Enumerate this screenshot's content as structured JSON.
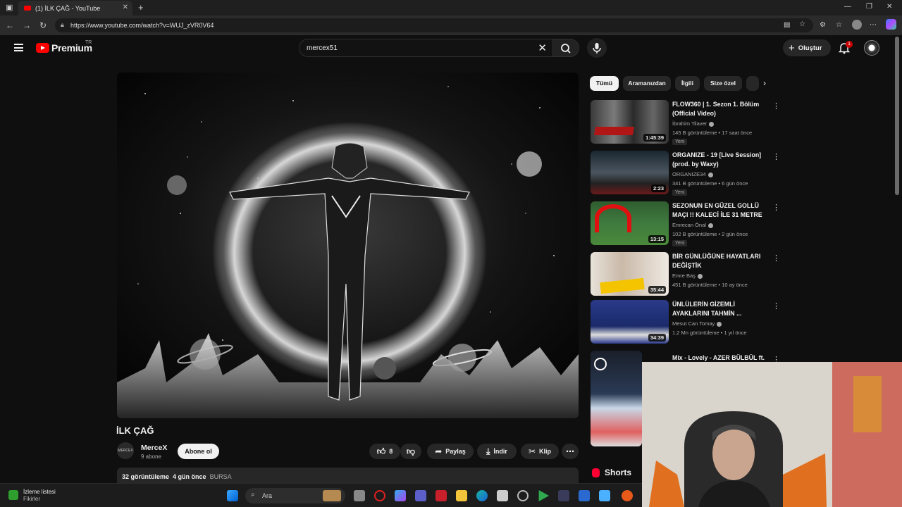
{
  "browser": {
    "tab_title": "(1) İLK ÇAĞ - YouTube",
    "url": "https://www.youtube.com/watch?v=WUJ_zVR0V64"
  },
  "header": {
    "logo_text": "Premium",
    "logo_region": "TR",
    "search_query": "mercex51",
    "create_label": "Oluştur",
    "notification_count": "1"
  },
  "video": {
    "title": "İLK ÇAĞ",
    "channel_name": "MerceX",
    "channel_avatar_text": "MERCEX",
    "subscribers": "9 abone",
    "subscribe_label": "Abone ol",
    "likes": "8",
    "share_label": "Paylaş",
    "download_label": "İndir",
    "clip_label": "Klip",
    "views": "32 görüntüleme",
    "age": "4 gün önce",
    "location": "BURSA"
  },
  "chips": [
    "Tümü",
    "Aramanızdan",
    "İlgili",
    "Size özel"
  ],
  "recommendations": [
    {
      "title": "FLOW360 | 1. Sezon 1. Bölüm (Official Video)",
      "channel": "İbrahim Tilaver",
      "meta": "145 B görüntüleme • 17 saat önce",
      "duration": "1:45:39",
      "badge": "Yeni"
    },
    {
      "title": "ORGANIZE - 19 [Live Session] (prod. by Waxy)",
      "channel": "ORGANIZE34",
      "meta": "341 B görüntüleme • 6 gün önce",
      "duration": "2:23",
      "badge": "Yeni"
    },
    {
      "title": "SEZONUN EN GÜZEL GOLLÜ MAÇI !! KALECİ İLE 31 METRE ...",
      "channel": "Emrecan Önal",
      "meta": "102 B görüntüleme • 2 gün önce",
      "duration": "13:15",
      "badge": "Yeni"
    },
    {
      "title": "BİR GÜNLÜĞÜNE HAYATLARI DEĞİŞTİK",
      "channel": "Emre Baş",
      "meta": "451 B görüntüleme • 10 ay önce",
      "duration": "35:44",
      "badge": ""
    },
    {
      "title": "ÜNLÜLERİN GİZEMLİ AYAKLARINI TAHMİN ...",
      "channel": "Mesut Can Tomay",
      "meta": "1,2 Mn görüntüleme • 1 yıl önce",
      "duration": "34:39",
      "badge": ""
    },
    {
      "title": "Mix - Lovely - AZER BÜLBÜL ft.",
      "channel": "",
      "meta": "",
      "duration": "",
      "badge": ""
    }
  ],
  "shorts_label": "Shorts",
  "taskbar": {
    "widget_title": "İzleme listesi",
    "widget_sub": "Fikirler",
    "search_label": "Ara"
  }
}
